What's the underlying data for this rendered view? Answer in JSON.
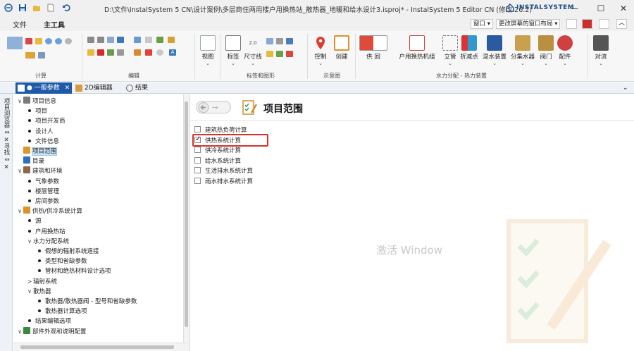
{
  "window": {
    "title": "D:\\文件\\InstalSystem 5 CN\\设计案例\\多层商住两用楼户用换热站_散热器_地暖和给水设计3.isproj* - InstalSystem 5 Editor CN (修改 26.2)",
    "brand": "INSTALSYSTEM",
    "minimize": "—",
    "maximize": "☐",
    "close": "✕"
  },
  "ribbon_tabs": {
    "file": "文件",
    "main_tools": "主工具",
    "window_menu": "窗口 ▾",
    "layout_menu": "更改屏幕的窗口布局 ▾"
  },
  "ribbon": {
    "groups": {
      "calc": "计算",
      "edit": "编辑",
      "annot": "标签和图形",
      "diagram": "示意图",
      "hydraulic": "水力分配 - 热力装置"
    },
    "buttons": {
      "view": "视图",
      "label": "标签",
      "dim": "尺寸线",
      "control": "控制",
      "create": "创建",
      "supply": "供 回",
      "source": "源",
      "substation": "户用换热机组",
      "riser": "立管",
      "break": "折减点",
      "mixing": "混水装置",
      "manifold": "分集水器",
      "valve": "阀门",
      "fitting": "配件",
      "convection": "对流"
    },
    "dim_value": "2.0"
  },
  "doc_tabs": {
    "general": "● 一般参数",
    "editor2d": "2D编辑器",
    "results": "结果",
    "close": "✕"
  },
  "side_tabs": {
    "project_browser": "项目浏览器",
    "find": "寻找"
  },
  "tree": [
    {
      "label": "项目信息",
      "level": 0,
      "exp": "∨",
      "icon": "doc-icon",
      "color": "#7a7a7a"
    },
    {
      "label": "项目",
      "level": 1,
      "bullet": true
    },
    {
      "label": "项目开发商",
      "level": 1,
      "bullet": true
    },
    {
      "label": "设计人",
      "level": 1,
      "bullet": true
    },
    {
      "label": "文件信息",
      "level": 1,
      "bullet": true
    },
    {
      "label": "项目范围",
      "level": 0,
      "icon": "checklist-icon",
      "color": "#d99a2b",
      "selected": true
    },
    {
      "label": "目录",
      "level": 0,
      "icon": "catalog-icon",
      "color": "#2f6fbf"
    },
    {
      "label": "建筑和环境",
      "level": 0,
      "exp": "∨",
      "icon": "building-icon",
      "color": "#8a6a4a"
    },
    {
      "label": "气象参数",
      "level": 1,
      "bullet": true
    },
    {
      "label": "楼层管理",
      "level": 1,
      "bullet": true
    },
    {
      "label": "房间参数",
      "level": 1,
      "bullet": true
    },
    {
      "label": "供热/供冷系统计算",
      "level": 0,
      "exp": "∨",
      "icon": "heat-icon",
      "color": "#e0902a"
    },
    {
      "label": "源",
      "level": 1,
      "bullet": true
    },
    {
      "label": "户用换热站",
      "level": 1,
      "bullet": true
    },
    {
      "label": "水力分配系统",
      "level": 1,
      "exp": "∨"
    },
    {
      "label": "假想的辐射系统连接",
      "level": 2,
      "bullet": true
    },
    {
      "label": "类型和省缺参数",
      "level": 2,
      "bullet": true
    },
    {
      "label": "管材和绝热材料设计选项",
      "level": 2,
      "bullet": true
    },
    {
      "label": "辐射系统",
      "level": 1,
      "exp": ">"
    },
    {
      "label": "散热器",
      "level": 1,
      "exp": "∨"
    },
    {
      "label": "散热器/散热器阀 - 型号和省缺参数",
      "level": 2,
      "bullet": true
    },
    {
      "label": "散热器计算选项",
      "level": 2,
      "bullet": true
    },
    {
      "label": "结果编辑选项",
      "level": 1,
      "bullet": true
    },
    {
      "label": "部件外观和说明配置",
      "level": 0,
      "exp": "∨",
      "icon": "palette-icon",
      "color": "#3a8a3a"
    }
  ],
  "content": {
    "title": "项目范围",
    "options": [
      {
        "label": "建筑热负荷计算",
        "checked": false
      },
      {
        "label": "供热系统计算",
        "checked": true
      },
      {
        "label": "供冷系统计算",
        "checked": false
      },
      {
        "label": "给水系统计算",
        "checked": false
      },
      {
        "label": "生活排水系统计算",
        "checked": false
      },
      {
        "label": "雨水排水系统计算",
        "checked": false
      }
    ]
  },
  "watermark": "激活 Window"
}
